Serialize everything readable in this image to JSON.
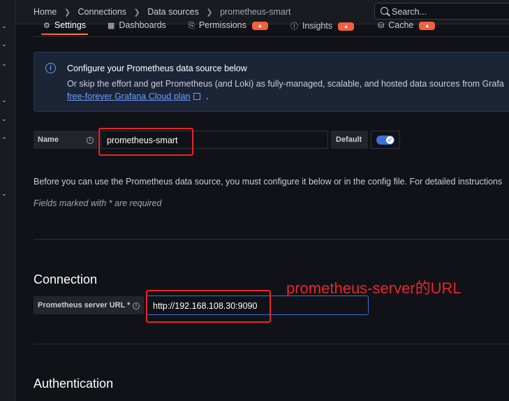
{
  "breadcrumb": {
    "items": [
      "Home",
      "Connections",
      "Data sources"
    ],
    "current": "prometheus-smart"
  },
  "search": {
    "placeholder": "Search..."
  },
  "tabs": [
    {
      "label": "Settings",
      "icon": "sliders-icon",
      "active": true,
      "badge": false
    },
    {
      "label": "Dashboards",
      "icon": "apps-icon",
      "active": false,
      "badge": false
    },
    {
      "label": "Permissions",
      "icon": "lock-icon",
      "active": false,
      "badge": true
    },
    {
      "label": "Insights",
      "icon": "info-icon",
      "active": false,
      "badge": true
    },
    {
      "label": "Cache",
      "icon": "database-icon",
      "active": false,
      "badge": true
    }
  ],
  "info_alert": {
    "title": "Configure your Prometheus data source below",
    "body": "Or skip the effort and get Prometheus (and Loki) as fully-managed, scalable, and hosted data sources from Grafa",
    "link": "free-forever Grafana Cloud plan",
    "trailing": "."
  },
  "name_field": {
    "label": "Name",
    "value": "prometheus-smart"
  },
  "default_field": {
    "label": "Default",
    "enabled": true
  },
  "instructions": "Before you can use the Prometheus data source, you must configure it below or in the config file. For detailed instructions",
  "required_note": "Fields marked with * are required",
  "connection": {
    "heading": "Connection",
    "url_label": "Prometheus server URL *",
    "url_value": "http://192.168.108.30:9090"
  },
  "authentication": {
    "heading": "Authentication"
  },
  "annotation": {
    "text": "prometheus-server的URL",
    "color": "#e8262c"
  },
  "colors": {
    "accent": "#3d71d9",
    "badge": "#f55f3e",
    "annotation": "#e8262c"
  },
  "sidebar_chevrons": [
    "down",
    "down",
    "down",
    "down",
    "down",
    "up",
    "down"
  ]
}
